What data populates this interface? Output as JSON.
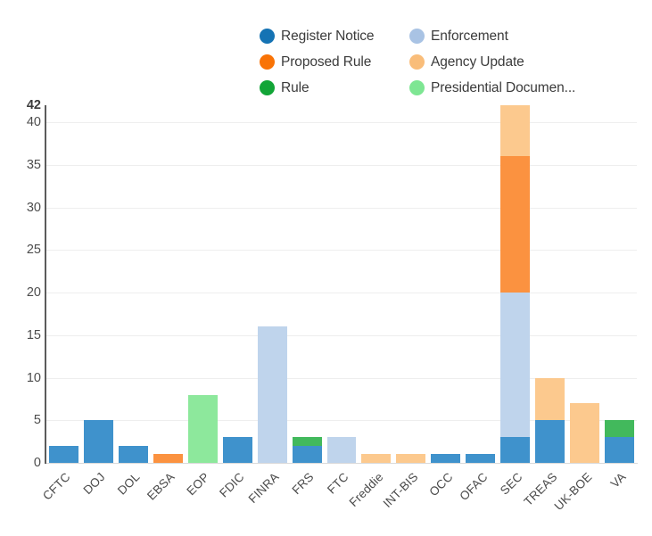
{
  "chart_data": {
    "type": "bar",
    "title": "",
    "subtitle": "",
    "xlabel": "",
    "ylabel": "",
    "stacked": true,
    "grid": true,
    "legend_position": "top-center",
    "ylim": [
      0,
      42
    ],
    "yticks": [
      0,
      5,
      10,
      15,
      20,
      25,
      30,
      35,
      40,
      42
    ],
    "ytick_labels": [
      "0",
      "5",
      "10",
      "15",
      "20",
      "25",
      "30",
      "35",
      "40",
      "42"
    ],
    "categories": [
      "CFTC",
      "DOJ",
      "DOL",
      "EBSA",
      "EOP",
      "FDIC",
      "FINRA",
      "FRS",
      "FTC",
      "Freddie",
      "INT-BIS",
      "OCC",
      "OFAC",
      "SEC",
      "TREAS",
      "UK-BOE",
      "VA"
    ],
    "series": [
      {
        "name": "Register Notice",
        "color": "#3f92cc",
        "legend_color": "#1573b4",
        "values": [
          2,
          5,
          2,
          0,
          0,
          3,
          0,
          2,
          0,
          0,
          0,
          1,
          1,
          3,
          5,
          0,
          3
        ]
      },
      {
        "name": "Enforcement",
        "color": "#bfd4ec",
        "legend_color": "#a9c3e4",
        "values": [
          0,
          0,
          0,
          0,
          0,
          0,
          16,
          0,
          3,
          0,
          0,
          0,
          0,
          17,
          0,
          0,
          0
        ]
      },
      {
        "name": "Proposed Rule",
        "color": "#fb9240",
        "legend_color": "#f97306",
        "values": [
          0,
          0,
          0,
          1,
          0,
          0,
          0,
          0,
          0,
          0,
          0,
          0,
          0,
          16,
          0,
          0,
          0
        ]
      },
      {
        "name": "Agency Update",
        "color": "#fcc98e",
        "legend_color": "#f9bd7a",
        "values": [
          0,
          0,
          0,
          0,
          0,
          0,
          0,
          0,
          0,
          1,
          1,
          0,
          0,
          6,
          5,
          7,
          0
        ]
      },
      {
        "name": "Rule",
        "color": "#42b95c",
        "legend_color": "#12a537",
        "values": [
          0,
          0,
          0,
          0,
          0,
          0,
          0,
          1,
          0,
          0,
          0,
          0,
          0,
          0,
          0,
          0,
          2
        ]
      },
      {
        "name": "Presidential Documen...",
        "color": "#8de89c",
        "legend_color": "#7ee693",
        "values": [
          0,
          0,
          0,
          0,
          8,
          0,
          0,
          0,
          0,
          0,
          0,
          0,
          0,
          0,
          0,
          0,
          0
        ]
      }
    ],
    "totals": [
      2,
      5,
      2,
      1,
      8,
      3,
      16,
      3,
      3,
      1,
      1,
      1,
      1,
      42,
      10,
      7,
      5
    ]
  },
  "legend": {
    "items": [
      {
        "label": "Register Notice",
        "color": "#1573b4"
      },
      {
        "label": "Enforcement",
        "color": "#a9c3e4"
      },
      {
        "label": "Proposed Rule",
        "color": "#f97306"
      },
      {
        "label": "Agency Update",
        "color": "#f9bd7a"
      },
      {
        "label": "Rule",
        "color": "#12a537"
      },
      {
        "label": "Presidential Documen...",
        "color": "#7ee693"
      }
    ]
  }
}
